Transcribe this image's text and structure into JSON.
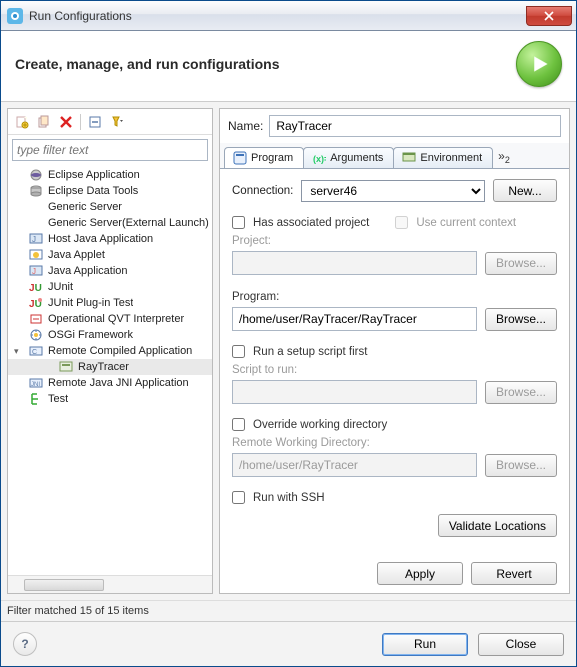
{
  "window": {
    "title": "Run Configurations"
  },
  "header": {
    "title": "Create, manage, and run configurations"
  },
  "left": {
    "filter_placeholder": "type filter text",
    "tree": [
      {
        "label": "Eclipse Application",
        "icon": "eclipse",
        "expandable": false
      },
      {
        "label": "Eclipse Data Tools",
        "icon": "db",
        "expandable": false
      },
      {
        "label": "Generic Server",
        "icon": "blank",
        "expandable": false
      },
      {
        "label": "Generic Server(External Launch)",
        "icon": "blank",
        "expandable": false
      },
      {
        "label": "Host Java Application",
        "icon": "java-host",
        "expandable": false
      },
      {
        "label": "Java Applet",
        "icon": "applet",
        "expandable": false
      },
      {
        "label": "Java Application",
        "icon": "java",
        "expandable": false
      },
      {
        "label": "JUnit",
        "icon": "junit",
        "expandable": false
      },
      {
        "label": "JUnit Plug-in Test",
        "icon": "junit-p",
        "expandable": false
      },
      {
        "label": "Operational QVT Interpreter",
        "icon": "qvt",
        "expandable": false
      },
      {
        "label": "OSGi Framework",
        "icon": "osgi",
        "expandable": false
      },
      {
        "label": "Remote Compiled Application",
        "icon": "remote-c",
        "expandable": true
      },
      {
        "label": "RayTracer",
        "icon": "raytracer",
        "expandable": false,
        "indent": true,
        "selected": true
      },
      {
        "label": "Remote Java JNI Application",
        "icon": "jni",
        "expandable": false
      },
      {
        "label": "Test",
        "icon": "test",
        "expandable": false
      }
    ],
    "status": "Filter matched 15 of 15 items"
  },
  "right": {
    "name_label": "Name:",
    "name_value": "RayTracer",
    "tabs": {
      "t0": "Program",
      "t1": "Arguments",
      "t2": "Environment",
      "more": "»₂"
    },
    "connection_label": "Connection:",
    "connection_value": "server46",
    "new_btn": "New...",
    "has_assoc": "Has associated project",
    "use_ctx": "Use current context",
    "project_label": "Project:",
    "browse": "Browse...",
    "program_label": "Program:",
    "program_value": "/home/user/RayTracer/RayTracer",
    "run_setup": "Run a setup script first",
    "script_label": "Script to run:",
    "override_wd": "Override working directory",
    "rwd_label": "Remote Working Directory:",
    "rwd_value": "/home/user/RayTracer",
    "run_ssh": "Run with SSH",
    "validate": "Validate Locations",
    "apply": "Apply",
    "revert": "Revert"
  },
  "footer": {
    "run": "Run",
    "close": "Close"
  }
}
